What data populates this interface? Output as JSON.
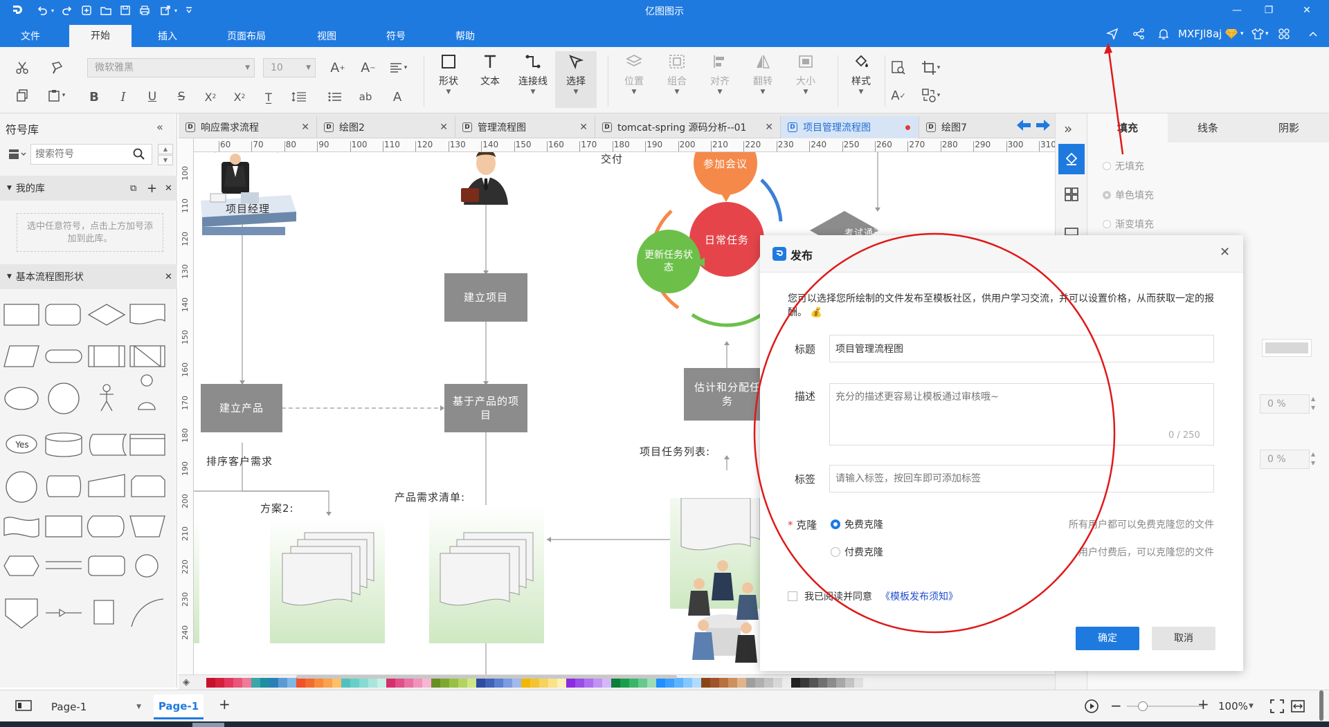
{
  "app": {
    "title": "亿图图示"
  },
  "menu": {
    "tabs": [
      "文件",
      "开始",
      "插入",
      "页面布局",
      "视图",
      "符号",
      "帮助"
    ],
    "active_index": 1,
    "user": "MXFJl8aj"
  },
  "ribbon": {
    "font": "微软雅黑",
    "font_size": "10",
    "tools": [
      "形状",
      "文本",
      "连接线",
      "选择"
    ],
    "arrange": [
      "位置",
      "组合",
      "对齐",
      "翻转",
      "大小"
    ],
    "style": "样式"
  },
  "left_panel": {
    "title": "符号库",
    "search_placeholder": "搜索符号",
    "my_library": "我的库",
    "my_library_hint": "选中任意符号，点击上方加号添加到此库。",
    "basic_flow": "基本流程图形状",
    "yes_label": "Yes"
  },
  "tabs": [
    {
      "label": "响应需求流程",
      "active": false
    },
    {
      "label": "绘图2",
      "active": false
    },
    {
      "label": "管理流程图",
      "active": false
    },
    {
      "label": "tomcat-spring 源码分析--01",
      "active": false
    },
    {
      "label": "项目管理流程图",
      "active": true
    },
    {
      "label": "绘图7",
      "active": false
    }
  ],
  "ruler": {
    "h": [
      "60",
      "70",
      "80",
      "90",
      "100",
      "110",
      "120",
      "130",
      "140",
      "150",
      "160",
      "170",
      "180",
      "190",
      "200",
      "210",
      "220",
      "230",
      "240",
      "250",
      "260",
      "270",
      "280",
      "290",
      "300",
      "310"
    ],
    "v": [
      "100",
      "110",
      "120",
      "130",
      "140",
      "150",
      "160",
      "170",
      "180",
      "190",
      "200",
      "210",
      "220",
      "230",
      "240"
    ]
  },
  "canvas": {
    "pm_label": "项目经理",
    "deliver": "交付",
    "create_project": "建立项目",
    "create_product": "建立产品",
    "product_based": "基于产品的项目",
    "sort_needs": "排序客户需求",
    "plan2": "方案2:",
    "req_list": "产品需求清单:",
    "meeting": "参加会议",
    "daily_task": "日常任务",
    "update_status": "更新任务状态",
    "estimate": "估计和分配任务",
    "task_list": "项目任务列表:",
    "exam": "考试通过了"
  },
  "dialog": {
    "title": "发布",
    "intro": "您可以选择您所绘制的文件发布至模板社区，供用户学习交流，并可以设置价格，从而获取一定的报酬。",
    "title_label": "标题",
    "title_value": "项目管理流程图",
    "desc_label": "描述",
    "desc_placeholder": "充分的描述更容易让模板通过审核哦~",
    "desc_count": "0 / 250",
    "tag_label": "标签",
    "tag_placeholder": "请输入标签，按回车即可添加标签",
    "clone_label": "克隆",
    "free_clone": "免费克隆",
    "free_desc": "所有用户都可以免费克隆您的文件",
    "paid_clone": "付费克隆",
    "paid_desc": "用户付费后，可以克隆您的文件",
    "agree": "我已阅读并同意",
    "agree_link": "《模板发布须知》",
    "ok": "确定",
    "cancel": "取消"
  },
  "right_panel": {
    "tabs": [
      "填充",
      "线条",
      "阴影"
    ],
    "options": [
      "无填充",
      "单色填充",
      "渐变填充"
    ],
    "pct1": "0 %",
    "pct2": "0 %"
  },
  "status": {
    "page_selector": "Page-1",
    "page_tab": "Page-1",
    "zoom": "100%"
  },
  "colors": {
    "accent": "#1f7ae0",
    "box": "#8c8c8c",
    "meeting": "#f5894a",
    "daily": "#e5454a",
    "update": "#6cc04a",
    "annotation": "#e01818"
  },
  "palette": [
    "#c8102e",
    "#d61f3b",
    "#e3385c",
    "#e8567a",
    "#f07a98",
    "#3aa6a9",
    "#1f8ea0",
    "#2b7fb8",
    "#5a9bd5",
    "#7fb8e6",
    "#f0512a",
    "#f36b2e",
    "#f78a3d",
    "#fba24f",
    "#ffbf69",
    "#4fc2c0",
    "#67cfc9",
    "#85dbd1",
    "#a7e6dc",
    "#c7f0e7",
    "#d62f6e",
    "#e0508a",
    "#e872a3",
    "#f094bc",
    "#f7b6d4",
    "#6b8e23",
    "#7ea832",
    "#97c045",
    "#b3d461",
    "#cfe685",
    "#2e4da0",
    "#3f63b8",
    "#5a7fd0",
    "#7c9be0",
    "#a2b9ee",
    "#f2b705",
    "#f4c430",
    "#f7d35c",
    "#fae289",
    "#fcefb8",
    "#8a2be2",
    "#9b4de8",
    "#ad6fee",
    "#c093f3",
    "#d4b7f8",
    "#0d7d3a",
    "#1a9e4e",
    "#3bb56a",
    "#68c98e",
    "#9bddb5",
    "#1e90ff",
    "#3aa0ff",
    "#5cb3ff",
    "#85c7ff",
    "#b0dbff",
    "#8b4513",
    "#a0522d",
    "#b8703f",
    "#cd9060",
    "#e0b48a",
    "#9e9e9e",
    "#b0b0b0",
    "#c4c4c4",
    "#d8d8d8",
    "#ececec",
    "#222222",
    "#3a3a3a",
    "#555555",
    "#707070",
    "#8c8c8c",
    "#a8a8a8",
    "#c4c4c4",
    "#e0e0e0",
    "#f2f2f2"
  ]
}
